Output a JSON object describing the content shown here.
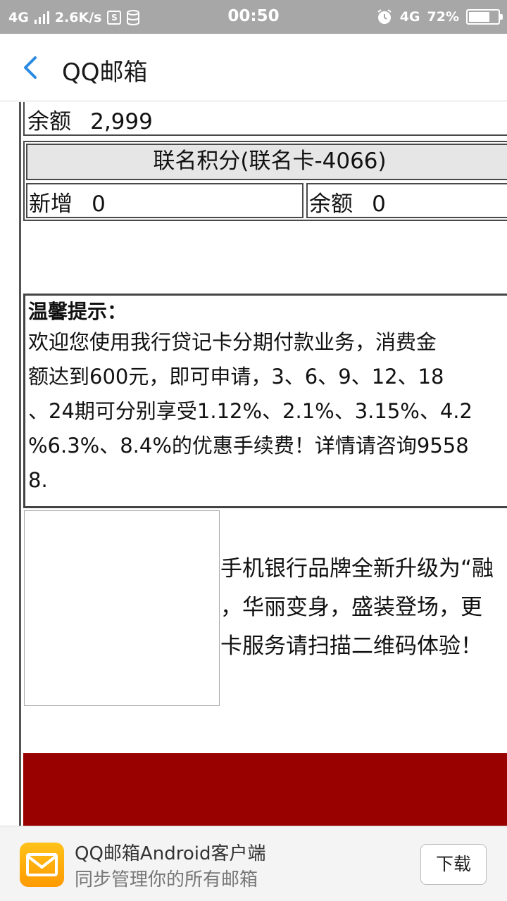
{
  "status_bar": {
    "network": "4G",
    "speed": "2.6K/s",
    "time": "00:50",
    "network_right": "4G",
    "battery": "72%",
    "battery_level": 0.72
  },
  "header": {
    "title": "QQ邮箱",
    "accent_color": "#2a8ae2"
  },
  "balance_row": {
    "label": "余额",
    "value": "2,999"
  },
  "points": {
    "heading": "联名积分(联名卡-4066)",
    "added_label": "新增",
    "added_value": "0",
    "balance_label": "余额",
    "balance_value": "0"
  },
  "tip": {
    "title": "温馨提示：",
    "lines": [
      "欢迎您使用我行贷记卡分期付款业务，消费金",
      "额达到600元，即可申请，3、6、9、12、18",
      "、24期可分别享受1.12%、2.1%、3.15%、4.2",
      "%6.3%、8.4%的优惠手续费！详情请咨询9558",
      "8."
    ]
  },
  "promo": {
    "lines": [
      "手机银行品牌全新升级为“融",
      "，华丽变身，盛装登场，更",
      "卡服务请扫描二维码体验！"
    ]
  },
  "colors": {
    "band": "#990000",
    "status_bar": "#a7a7a7"
  },
  "banner": {
    "icon": "mail-icon",
    "title": "QQ邮箱Android客户端",
    "subtitle": "同步管理你的所有邮箱",
    "button": "下载"
  }
}
